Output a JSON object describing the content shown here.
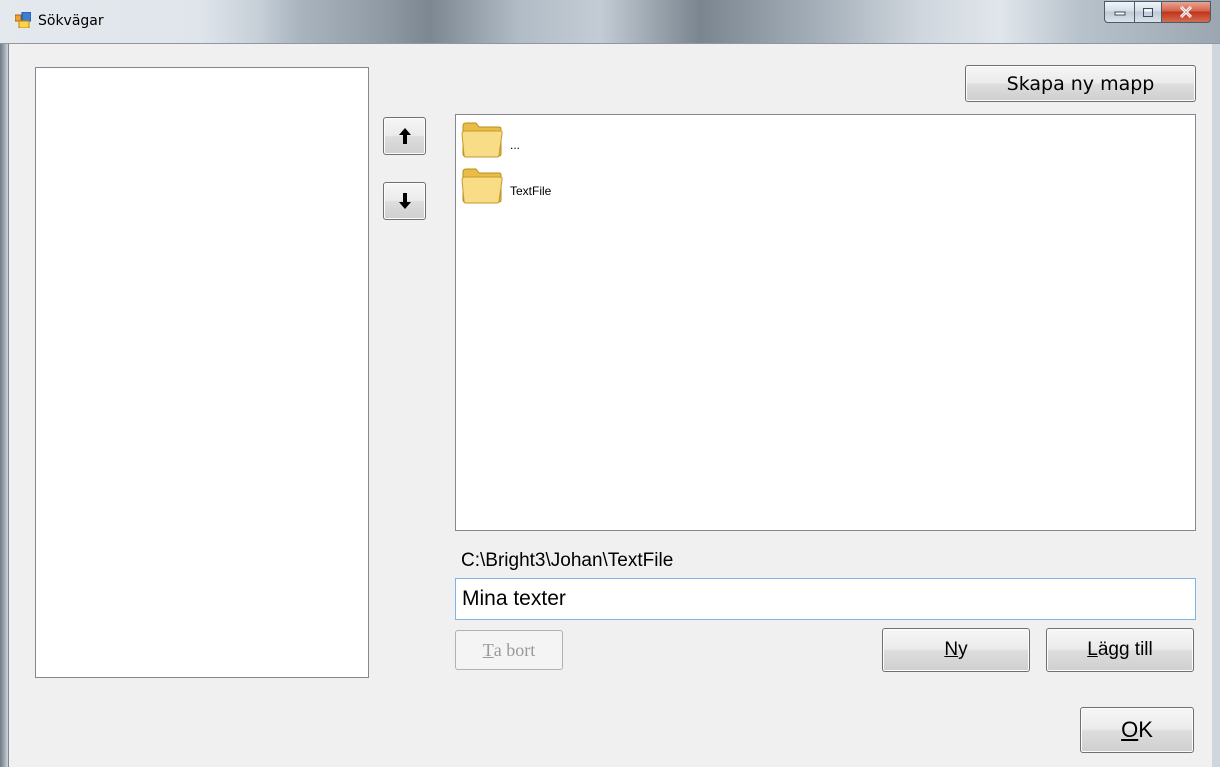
{
  "window": {
    "title": "Sökvägar"
  },
  "toolbar": {
    "create_folder_label": "Skapa ny mapp"
  },
  "file_list": {
    "items": [
      {
        "label": "...",
        "icon": "folder-icon"
      },
      {
        "label": "TextFile",
        "icon": "folder-icon"
      }
    ]
  },
  "path": {
    "current": "C:\\Bright3\\Johan\\TextFile"
  },
  "name_field": {
    "value": "Mina texter"
  },
  "buttons": {
    "remove": {
      "accel": "T",
      "rest": "a bort"
    },
    "new": {
      "accel": "N",
      "rest": "y"
    },
    "add": {
      "accel": "L",
      "rest": "ägg till"
    },
    "ok": {
      "accel": "O",
      "rest": "K"
    }
  },
  "icons": {
    "move_up": "arrow-up-icon",
    "move_down": "arrow-down-icon"
  },
  "colors": {
    "close_button": "#c9432a",
    "input_focus_border": "#7eb4ea",
    "folder_yellow": "#f6d675"
  }
}
